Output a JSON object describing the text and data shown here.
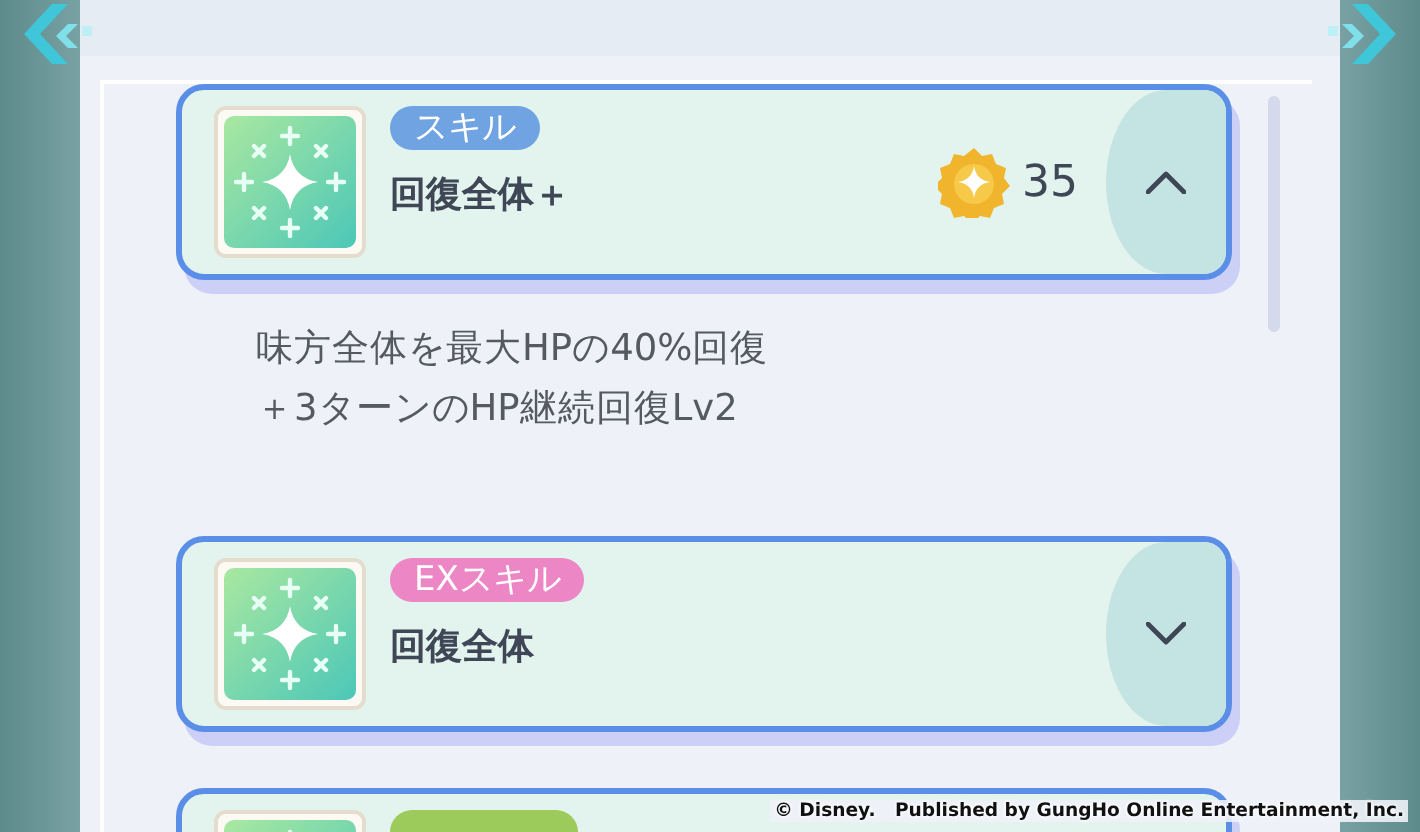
{
  "skills": [
    {
      "tag": "スキル",
      "color": "#6fa3e2",
      "name": "回復全体＋",
      "cost": "35",
      "expanded": true,
      "description_lines": [
        "味方全体を最大HPの40%回復",
        "＋3ターンのHP継続回復Lv2"
      ]
    },
    {
      "tag": "EXスキル",
      "color": "#ec86c4",
      "name": "回復全体",
      "expanded": false
    },
    {
      "color": "#9ccb5c"
    }
  ],
  "footer_notice": "© Disney.   Published by GungHo Online Entertainment, Inc."
}
